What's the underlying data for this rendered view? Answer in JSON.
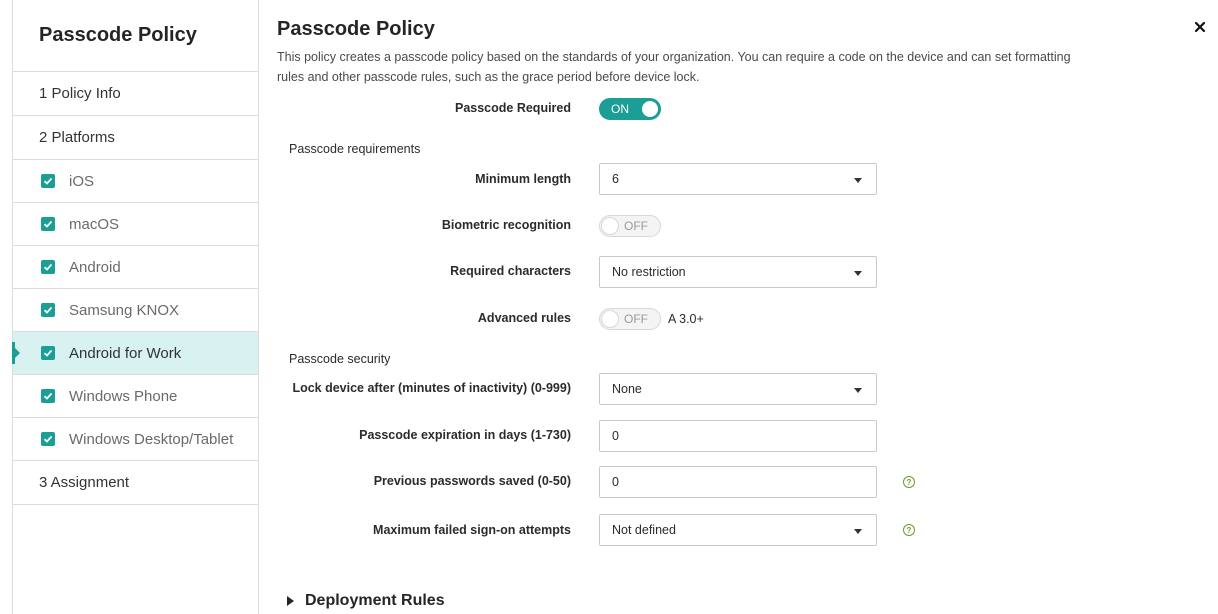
{
  "sidebar": {
    "title": "Passcode Policy",
    "steps": [
      {
        "label": "1  Policy Info"
      },
      {
        "label": "2  Platforms"
      }
    ],
    "platforms": [
      {
        "label": "iOS",
        "checked": true
      },
      {
        "label": "macOS",
        "checked": true
      },
      {
        "label": "Android",
        "checked": true
      },
      {
        "label": "Samsung KNOX",
        "checked": true
      },
      {
        "label": "Android for Work",
        "checked": true,
        "active": true
      },
      {
        "label": "Windows Phone",
        "checked": true
      },
      {
        "label": "Windows Desktop/Tablet",
        "checked": true
      }
    ],
    "assignment": {
      "label": "3  Assignment"
    }
  },
  "main": {
    "title": "Passcode Policy",
    "description": "This policy creates a passcode policy based on the standards of your organization. You can require a code on the device and can set formatting rules and other passcode rules, such as the grace period before device lock.",
    "passcode_required": {
      "label": "Passcode Required",
      "state": "ON"
    },
    "requirements_section": "Passcode requirements",
    "minimum_length": {
      "label": "Minimum length",
      "value": "6"
    },
    "biometric": {
      "label": "Biometric recognition",
      "state": "OFF"
    },
    "required_chars": {
      "label": "Required characters",
      "value": "No restriction"
    },
    "advanced_rules": {
      "label": "Advanced rules",
      "state": "OFF",
      "suffix": "A 3.0+"
    },
    "security_section": "Passcode security",
    "lock_device": {
      "label": "Lock device after (minutes of inactivity) (0-999)",
      "value": "None"
    },
    "expiration": {
      "label": "Passcode expiration in days (1-730)",
      "value": "0"
    },
    "previous_passwords": {
      "label": "Previous passwords saved (0-50)",
      "value": "0"
    },
    "max_failed": {
      "label": "Maximum failed sign-on attempts",
      "value": "Not defined"
    },
    "deployment_rules": "Deployment Rules"
  },
  "icons": {
    "close": "close-icon",
    "help": "help-icon",
    "check": "checkmark-icon"
  },
  "colors": {
    "accent": "#1a9e95",
    "active_bg": "#d8f2f1",
    "help": "#6f9a2c"
  }
}
